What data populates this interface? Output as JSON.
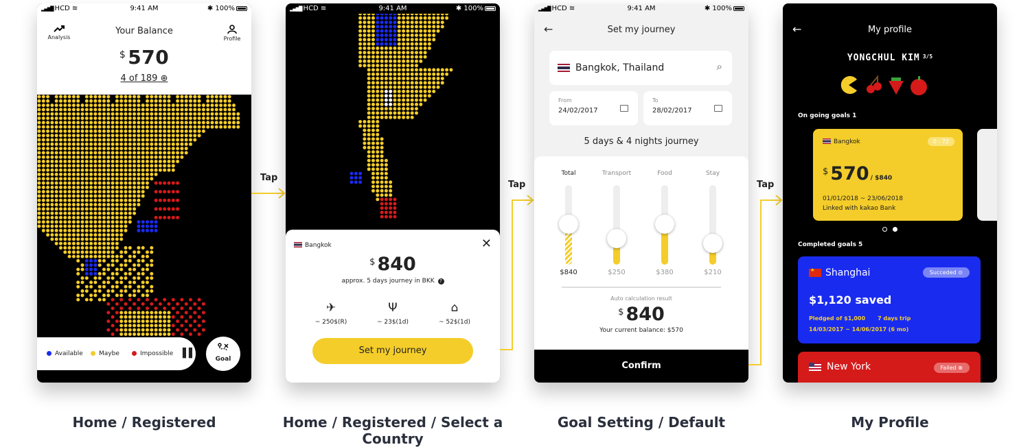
{
  "status": {
    "carrier": "HCD",
    "time": "9:41 AM",
    "battery": "100%"
  },
  "tap_label": "Tap",
  "colors": {
    "yellow": "#f4cd2a",
    "blue": "#1a2bf0",
    "red": "#d51a1a",
    "available": "#1a2bf0",
    "maybe": "#f4cd2a",
    "impossible": "#d51a1a"
  },
  "screens": [
    {
      "caption": "Home / Registered",
      "analysis_label": "Analysis",
      "analysis_icon": "trending-up-icon",
      "title": "Your Balance",
      "profile_label": "Profile",
      "profile_icon": "person-icon",
      "currency": "$",
      "balance": "570",
      "count": "4 of 189",
      "legend": {
        "available": "Available",
        "maybe": "Maybe",
        "impossible": "Impossible"
      },
      "goal_label": "Goal"
    },
    {
      "caption": "Home / Registered / Select a Country",
      "country": "Bangkok",
      "currency": "$",
      "price": "840",
      "subtitle": "approx. 5 days journey in BKK",
      "costs": [
        {
          "icon": "airplane-icon",
          "value": "~ 250$(R)"
        },
        {
          "icon": "fork-knife-icon",
          "value": "~ 23$(1d)"
        },
        {
          "icon": "house-icon",
          "value": "~ 52$(1d)"
        }
      ],
      "cta": "Set my journey"
    },
    {
      "caption": "Goal Setting / Default",
      "title": "Set my journey",
      "search_value": "Bangkok, Thailand",
      "from_label": "From",
      "from_value": "24/02/2017",
      "to_label": "To",
      "to_value": "28/02/2017",
      "duration": "5 days & 4 nights journey",
      "sliders": [
        {
          "label": "Total",
          "amount": "$840",
          "level": 0.51
        },
        {
          "label": "Transport",
          "amount": "$250",
          "level": 0.33
        },
        {
          "label": "Food",
          "amount": "$380",
          "level": 0.51
        },
        {
          "label": "Stay",
          "amount": "$210",
          "level": 0.27
        }
      ],
      "auto_label": "Auto calculation result",
      "currency": "$",
      "auto_amount": "840",
      "current_balance": "Your current balance: $570",
      "confirm": "Confirm"
    },
    {
      "caption": "My Profile",
      "title": "My profile",
      "username": "YONGCHUL KIM",
      "level": "3/5",
      "trophies": [
        "pacman-icon",
        "cherry-icon",
        "strawberry-icon",
        "apple-icon"
      ],
      "ongoing_label": "On going goals 1",
      "ongoing": {
        "country": "Bangkok",
        "days": "0 - 72",
        "currency": "$",
        "amount": "570",
        "target": "/ $840",
        "dates": "01/01/2018 ~ 23/06/2018",
        "linked": "Linked with kakao Bank"
      },
      "completed_label": "Completed goals 5",
      "completed": [
        {
          "city": "Shanghai",
          "status": "Succeded",
          "saved": "$1,120 saved",
          "pledged": "Pledged of $1,000",
          "trip": "7 days trip",
          "range": "14/03/2017 ~ 14/06/2017 (6 mo)"
        },
        {
          "city": "New York",
          "status": "Failed"
        }
      ]
    }
  ]
}
